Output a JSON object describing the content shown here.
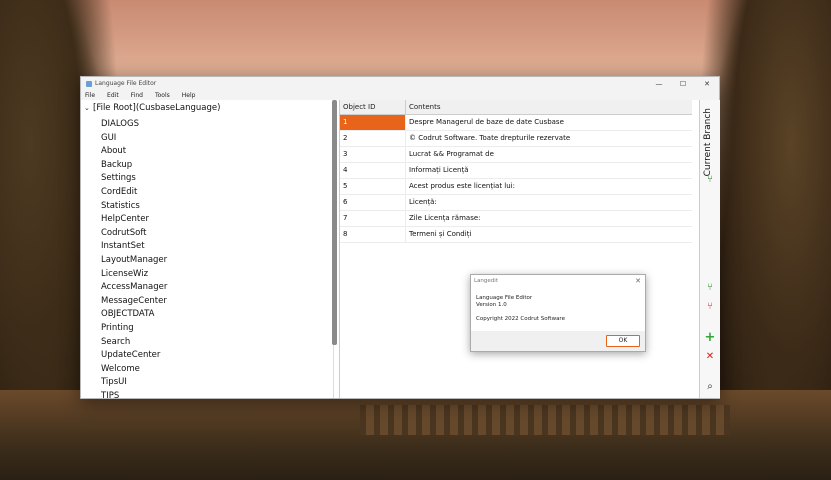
{
  "window": {
    "title": "Language File Editor",
    "controls": {
      "minimize": "—",
      "maximize": "☐",
      "close": "✕"
    }
  },
  "menu": [
    "File",
    "Edit",
    "Find",
    "Tools",
    "Help"
  ],
  "tree": {
    "root": "[File Root](CusbaseLanguage)",
    "items": [
      "DIALOGS",
      "GUI",
      "About",
      "Backup",
      "Settings",
      "CordEdit",
      "Statistics",
      "HelpCenter",
      "CodrutSoft",
      "InstantSet",
      "LayoutManager",
      "LicenseWiz",
      "AccessManager",
      "MessageCenter",
      "OBJECTDATA",
      "Printing",
      "Search",
      "UpdateCenter",
      "Welcome",
      "TipsUI",
      "TIPS"
    ]
  },
  "table": {
    "headers": [
      "Object ID",
      "Contents"
    ],
    "rows": [
      {
        "id": "1",
        "contents": "Despre Managerul de baze de date Cusbase"
      },
      {
        "id": "2",
        "contents": "© Codrut Software. Toate drepturile rezervate"
      },
      {
        "id": "3",
        "contents": "Lucrat && Programat de"
      },
      {
        "id": "4",
        "contents": "Informați Licență"
      },
      {
        "id": "5",
        "contents": "Acest produs este licențiat lui:"
      },
      {
        "id": "6",
        "contents": "Licență:"
      },
      {
        "id": "7",
        "contents": "Zile Licența rămase:"
      },
      {
        "id": "8",
        "contents": "Termeni și Condiți"
      }
    ],
    "selected_row": 0,
    "selection_color": "#e8641b"
  },
  "right_panel": {
    "label": "Current Branch",
    "icons": [
      "branch-icon",
      "branch-add-icon",
      "branch-remove-icon",
      "add-icon",
      "delete-icon",
      "search-icon"
    ]
  },
  "dialog": {
    "title": "Langedit",
    "line1": "Language File Editor",
    "line2": "Version 1.0",
    "line3": "Copyright 2022 Codrut Software",
    "ok": "OK"
  }
}
